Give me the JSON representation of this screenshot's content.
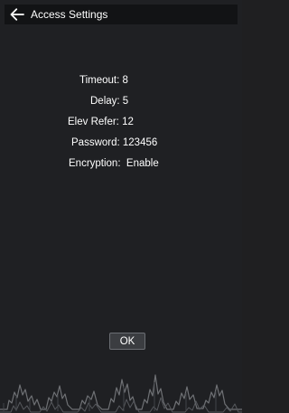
{
  "window": {
    "title": "Access Settings"
  },
  "fields": {
    "timeout": "Timeout: 8",
    "delay": "Delay: 5",
    "elev_refer": "Elev Refer: 12",
    "password": "Password: 123456",
    "encryption": "Encryption:  Enable"
  },
  "actions": {
    "ok_label": "OK"
  },
  "colors": {
    "background": "#1f2023",
    "titlebar": "#121315",
    "text": "#ffffff",
    "button": "#3b3d41"
  }
}
